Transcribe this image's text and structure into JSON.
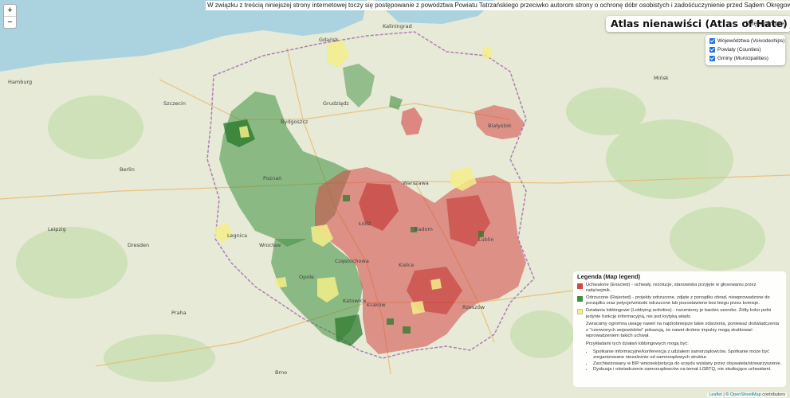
{
  "banner": "W związku z treścią niniejszej strony internetowej toczy się postępowanie z powództwa Powiatu Tatrzańskiego przeciwko autorom strony o ochronę dóbr osobistych i zadośćuczynienie przed Sądem Okręgowym w Nowym Sączu.",
  "zoom": {
    "in": "+",
    "out": "−"
  },
  "title": "Atlas nienawiści (Atlas of Hate)",
  "more_link": "Więcej (more)",
  "layers": [
    {
      "label": "Województwa (Voivodeships)",
      "checked": true
    },
    {
      "label": "Powiaty (Counties)",
      "checked": true
    },
    {
      "label": "Gminy (Municipalities)",
      "checked": true
    }
  ],
  "legend": {
    "title": "Legenda (Map legend)",
    "items": [
      {
        "color": "#d64545",
        "text": "Uchwalone (Enacted) - uchwały, rezolucje, stanowiska przyjęte w głosowaniu przez radę/sejmik."
      },
      {
        "color": "#3f8f3f",
        "text": "Odrzucone (Rejected) - projekty odrzucone, zdjęte z porządku obrad, niewprowadzone do porządku oraz petycje/wnioski odrzucone lub pozostawione bez biegu przez komisje."
      },
      {
        "color": "#f3ef8a",
        "text": "Działania lobbingowe (Lobbying activities) - rozumiemy je bardzo szeroko. Żółty kolor pełni jedynie funkcję informacyjną, nie jest krytyką władz."
      }
    ],
    "note": "Zwracamy ogromną uwagę nawet na najdrobniejsze takie zdarzenia, ponieważ doświadczenia z \"czerwonych województw\" pokazują, że nawet drobne impulsy mogą skutkować wprowadzeniem takich uchwał.",
    "examples_title": "Przykładami tych działań lobbingowych mogą być:",
    "examples": [
      "Spotkanie informacyjne/konferencja z udziałem samorządowców. Spotkanie może być zorganizowane niezależnie od samorządowych struktur.",
      "Zarchiwizowany w BIP wniosek/petycja do urzędu wysłany przez obywatela/stowarzyszenie.",
      "Dyskusja i oświadczenie samorządowców na temat LGBTQ, nie skutkujące uchwałami."
    ]
  },
  "attribution": {
    "leaflet": "Leaflet",
    "sep": " | © ",
    "osm": "OpenStreetMap",
    "tail": " contributors"
  },
  "cities": [
    {
      "name": "Kaliningrad",
      "cls": "a"
    },
    {
      "name": "Gdańsk",
      "cls": "b"
    },
    {
      "name": "Szczecin",
      "cls": "c"
    },
    {
      "name": "Bydgoszcz",
      "cls": "d"
    },
    {
      "name": "Grudziądz",
      "cls": "e"
    },
    {
      "name": "Białystok",
      "cls": "f"
    },
    {
      "name": "Warszawa",
      "cls": "g"
    },
    {
      "name": "Poznań",
      "cls": "h"
    },
    {
      "name": "Łódź",
      "cls": "i"
    },
    {
      "name": "Wrocław",
      "cls": "j"
    },
    {
      "name": "Opole",
      "cls": "k"
    },
    {
      "name": "Katowice",
      "cls": "l"
    },
    {
      "name": "Kraków",
      "cls": "m"
    },
    {
      "name": "Lublin",
      "cls": "n"
    },
    {
      "name": "Rzeszów",
      "cls": "o"
    },
    {
      "name": "Kielce",
      "cls": "p"
    },
    {
      "name": "Radom",
      "cls": "q"
    },
    {
      "name": "Częstochowa",
      "cls": "r"
    },
    {
      "name": "Dresden",
      "cls": "s"
    },
    {
      "name": "Berlin",
      "cls": "t"
    },
    {
      "name": "Praha",
      "cls": "u"
    },
    {
      "name": "Mińsk",
      "cls": "v"
    },
    {
      "name": "Brno",
      "cls": "w"
    },
    {
      "name": "Legnica",
      "cls": "x"
    },
    {
      "name": "Hamburg",
      "cls": "y"
    },
    {
      "name": "Leipzig",
      "cls": "z"
    }
  ]
}
